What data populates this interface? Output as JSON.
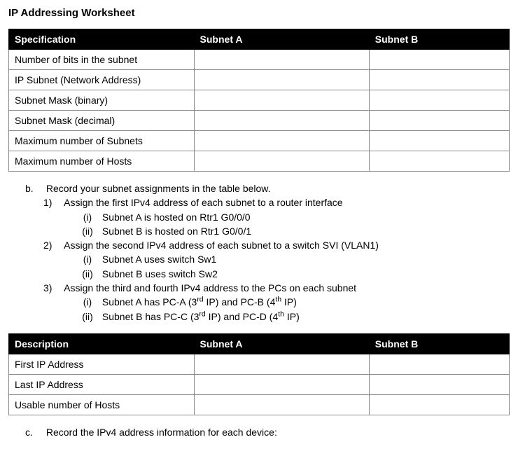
{
  "title": "IP Addressing Worksheet",
  "table1": {
    "headers": [
      "Specification",
      "Subnet A",
      "Subnet B"
    ],
    "rows": [
      "Number of bits in the subnet",
      "IP Subnet (Network Address)",
      "Subnet Mask (binary)",
      "Subnet Mask (decimal)",
      "Maximum number of Subnets",
      "Maximum number of Hosts"
    ]
  },
  "instr": {
    "b_label": "b.",
    "b_text": "Record your subnet assignments in the table below.",
    "n1_label": "1)",
    "n1_text": "Assign the first IPv4 address of each subnet to a router interface",
    "n1_i_label": "(i)",
    "n1_i_text": "Subnet A is hosted on Rtr1 G0/0/0",
    "n1_ii_label": "(ii)",
    "n1_ii_text": "Subnet B is hosted on Rtr1 G0/0/1",
    "n2_label": "2)",
    "n2_text": "Assign the second IPv4 address of each subnet to a switch SVI (VLAN1)",
    "n2_i_label": "(i)",
    "n2_i_text": "Subnet A uses switch Sw1",
    "n2_ii_label": "(ii)",
    "n2_ii_text": "Subnet B uses switch Sw2",
    "n3_label": "3)",
    "n3_text": "Assign the third and fourth IPv4 address to the PCs on each subnet",
    "n3_i_label": "(i)",
    "n3_i_html": "Subnet A has PC-A (3<sup>rd</sup> IP) and PC-B (4<sup>th</sup> IP)",
    "n3_ii_label": "(ii)",
    "n3_ii_html": "Subnet B has PC-C (3<sup>rd</sup> IP) and PC-D (4<sup>th</sup> IP)"
  },
  "table2": {
    "headers": [
      "Description",
      "Subnet A",
      "Subnet B"
    ],
    "rows": [
      "First IP Address",
      "Last IP Address",
      "Usable number of Hosts"
    ]
  },
  "c_label": "c.",
  "c_text": "Record the IPv4 address information for each device:"
}
